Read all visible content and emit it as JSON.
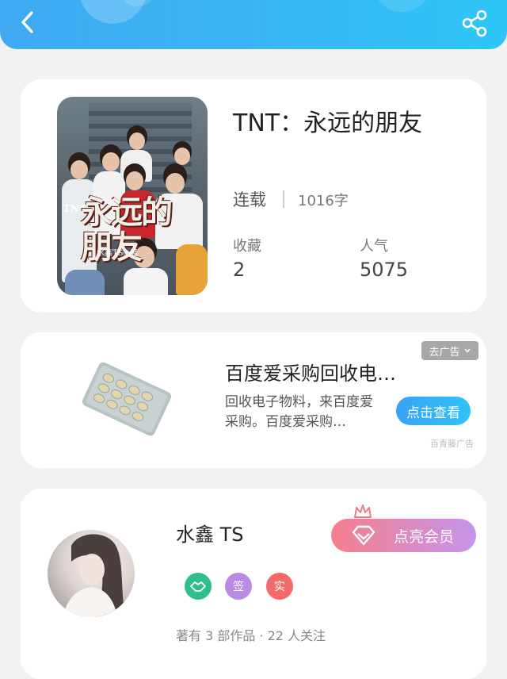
{
  "header": {
    "back_icon": "chevron-left-icon",
    "share_icon": "share-icon"
  },
  "book": {
    "title": "TNT：永远的朋友",
    "cover_title": "永远的朋友",
    "cover_prefix": "TNT:",
    "cover_author": "水鑫TS◎著",
    "status": "连载",
    "word_count": "1016字",
    "stats": [
      {
        "label": "收藏",
        "value": "2"
      },
      {
        "label": "人气",
        "value": "5075"
      }
    ]
  },
  "ad": {
    "close_label": "去广告",
    "title": "百度爱采购回收电…",
    "description": "回收电子物料，来百度爱采购。百度爱采购…",
    "button_label": "点击查看",
    "source": "百青藤广告"
  },
  "author": {
    "name": "水鑫 TS",
    "vip_button_label": "点亮会员",
    "badges": [
      {
        "icon": "handshake-icon",
        "label": "",
        "color": "#2fbf8c"
      },
      {
        "icon": "sign-badge",
        "label": "签",
        "color": "#b98be6"
      },
      {
        "icon": "real-badge",
        "label": "实",
        "color": "#f26a6a"
      }
    ],
    "meta": "著有 3 部作品 · 22 人关注"
  },
  "colors": {
    "header": "#39b6f5",
    "accent": "#2ec4f7",
    "vip_start": "#f57f8c",
    "vip_end": "#c594ec"
  }
}
